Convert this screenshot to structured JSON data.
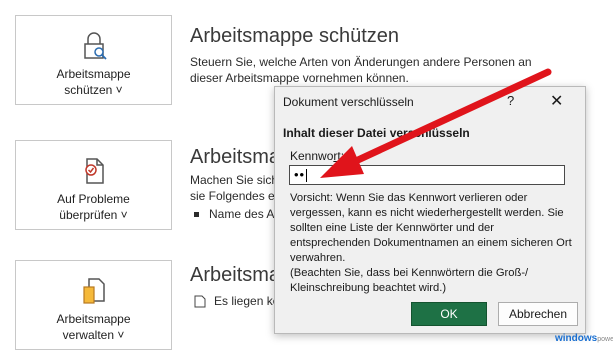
{
  "cards": [
    {
      "label_line1": "Arbeitsmappe",
      "label_line2": "schützen ˅",
      "icon": "lock-search-icon"
    },
    {
      "label_line1": "Auf Probleme",
      "label_line2": "überprüfen ˅",
      "icon": "document-check-icon"
    },
    {
      "label_line1": "Arbeitsmappe",
      "label_line2": "verwalten ˅",
      "icon": "workbook-manage-icon"
    }
  ],
  "sections": {
    "protect": {
      "title": "Arbeitsmappe schützen",
      "desc_line1": "Steuern Sie, welche Arten von Änderungen andere Personen an",
      "desc_line2": "dieser Arbeitsmappe vornehmen können."
    },
    "inspect": {
      "title": "Arbeitsmap",
      "desc_line1": "Machen Sie sich",
      "desc_line2": "sie Folgendes er",
      "bullet": "Name des A"
    },
    "manage": {
      "title": "Arbeitsmap",
      "bullet": "Es liegen kein"
    }
  },
  "dialog": {
    "title": "Dokument verschlüsseln",
    "help": "?",
    "close": "✕",
    "heading": "Inhalt dieser Datei verschlüsseln",
    "password_label_prefix": "Kennwo",
    "password_label_underlined": "r",
    "password_label_suffix": "t:",
    "password_value": "••",
    "warning": "Vorsicht: Wenn Sie das Kennwort verlieren oder vergessen, kann es nicht wiederhergestellt werden. Sie sollten eine Liste der Kennwörter und der entsprechenden Dokumentnamen an einem sicheren Ort verwahren.",
    "warning2": "(Beachten Sie, dass bei Kennwörtern die Groß-/ Kleinschreibung beachtet wird.)",
    "ok_label": "OK",
    "cancel_label": "Abbrechen"
  },
  "watermark": {
    "brand": "windows",
    "suffix": "power"
  },
  "colors": {
    "ok_button": "#1e7145",
    "arrow": "#e0141b",
    "accent": "#1a6fd0"
  }
}
